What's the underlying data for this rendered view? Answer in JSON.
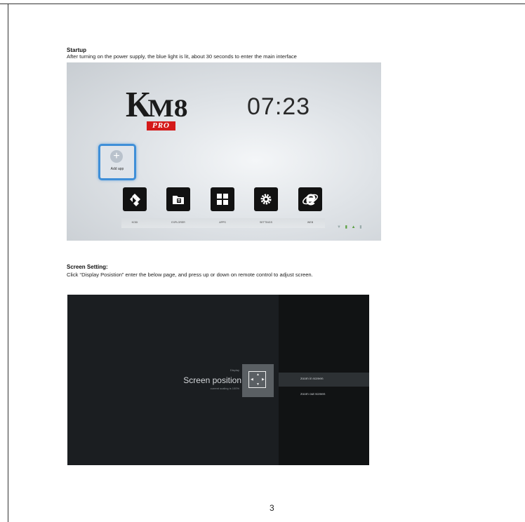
{
  "startup": {
    "heading": "Startup",
    "text": "After turning on the power supply, the blue light is lit, about 30 seconds to enter the main interface",
    "screen": {
      "logo_main": "K",
      "logo_tail": "M8",
      "logo_badge": "PRO",
      "clock": "07:23",
      "add_app_label": "Add app",
      "add_app_symbol": "+",
      "apps": [
        {
          "label": "KODI",
          "icon": "kodi-icon"
        },
        {
          "label": "EXPLORER",
          "icon": "folder-icon"
        },
        {
          "label": "APPS",
          "icon": "grid-icon"
        },
        {
          "label": "SETTINGS",
          "icon": "gear-icon"
        },
        {
          "label": "WEB",
          "icon": "browser-icon"
        }
      ],
      "status_icons": [
        "wifi-icon",
        "usb-icon",
        "android-icon",
        "sd-icon"
      ]
    }
  },
  "screen_setting": {
    "heading": "Screen Setting:",
    "text": "Click “Display Posistion” enter the below page, and press up or down on remote control to adjust screen.",
    "tv": {
      "category": "Display",
      "title": "Screen position",
      "subtitle": "current scaling is 100%",
      "options": [
        "zoom in screen",
        "zoom out screen"
      ],
      "selected_option": "zoom in screen"
    }
  },
  "page_number": "3",
  "colors": {
    "accent_blue": "#3f8fd8",
    "pro_red": "#d41a1a",
    "tv_bg": "#1b1e21"
  }
}
